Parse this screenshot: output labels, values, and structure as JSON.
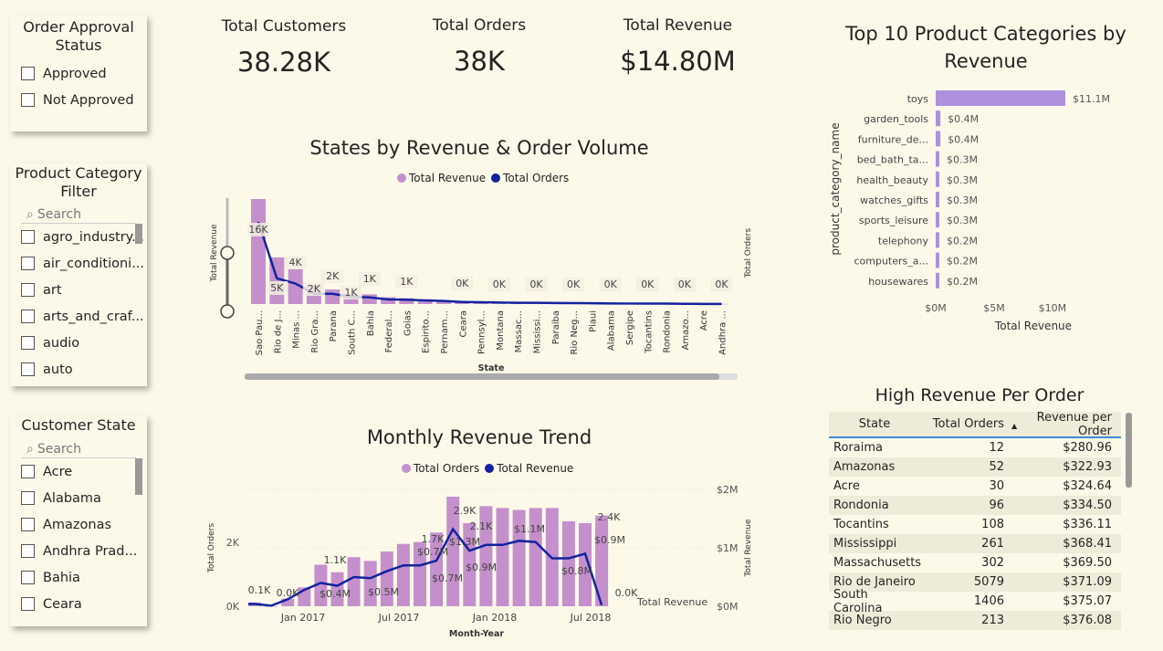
{
  "slicer_approval": {
    "title": "Order Approval Status",
    "items": [
      "Approved",
      "Not Approved"
    ]
  },
  "slicer_category": {
    "title": "Product Category Filter",
    "search_placeholder": "Search",
    "items": [
      "agro_industry...",
      "air_conditioni...",
      "art",
      "arts_and_craf...",
      "audio",
      "auto"
    ]
  },
  "slicer_state": {
    "title": "Customer State",
    "search_placeholder": "Search",
    "items": [
      "Acre",
      "Alabama",
      "Amazonas",
      "Andhra Prad...",
      "Bahia",
      "Ceara"
    ]
  },
  "kpis": {
    "customers_label": "Total Customers",
    "customers_value": "38.28K",
    "orders_label": "Total Orders",
    "orders_value": "38K",
    "revenue_label": "Total Revenue",
    "revenue_value": "$14.80M"
  },
  "states_chart": {
    "title": "States by Revenue & Order Volume",
    "legend": [
      "Total Revenue",
      "Total Orders"
    ],
    "xlabel": "State",
    "ylabel_left": "Total Revenue",
    "ylabel_right": "Total Orders"
  },
  "monthly_chart": {
    "title": "Monthly Revenue Trend",
    "legend": [
      "Total Orders",
      "Total Revenue"
    ],
    "xlabel": "Month-Year",
    "ylabel_left": "Total Orders",
    "ylabel_right": "Total Revenue",
    "line_end_label": "Total Revenue"
  },
  "top10_chart": {
    "title": "Top 10 Product Categories by Revenue",
    "xlabel": "Total Revenue",
    "ylabel": "product_category_name"
  },
  "table": {
    "title": "High Revenue Per Order",
    "headers": [
      "State",
      "Total Orders",
      "Revenue per Order"
    ],
    "rows": [
      [
        "Roraima",
        "12",
        "$280.96"
      ],
      [
        "Amazonas",
        "52",
        "$322.93"
      ],
      [
        "Acre",
        "30",
        "$324.64"
      ],
      [
        "Rondonia",
        "96",
        "$334.50"
      ],
      [
        "Tocantins",
        "108",
        "$336.11"
      ],
      [
        "Mississippi",
        "261",
        "$368.41"
      ],
      [
        "Massachusetts",
        "302",
        "$369.50"
      ],
      [
        "Rio de Janeiro",
        "5079",
        "$371.09"
      ],
      [
        "South Carolina",
        "1406",
        "$375.07"
      ],
      [
        "Rio Negro",
        "213",
        "$376.08"
      ]
    ]
  },
  "colors": {
    "bar_purple": "#c490cb",
    "top10_bar": "#ae90dc",
    "line_navy": "#12239e",
    "background": "#fcf9e9"
  },
  "chart_data": [
    {
      "type": "bar",
      "title": "States by Revenue & Order Volume",
      "xlabel": "State",
      "ylabel": "Total Revenue",
      "categories": [
        "Sao Pau...",
        "Rio de J...",
        "Minas ...",
        "Rio Gra...",
        "Parana",
        "South C...",
        "Bahia",
        "Federal...",
        "Goias",
        "Espirito...",
        "Pernam...",
        "Ceara",
        "Pennsyl...",
        "Montana",
        "Massac...",
        "Mississi...",
        "Paraiba",
        "Rio Neg...",
        "Piaui",
        "Alabama",
        "Sergipe",
        "Tocantins",
        "Rondonia",
        "Amazo...",
        "Acre",
        "Andhra ..."
      ],
      "series": [
        {
          "name": "Total Revenue",
          "values": [
            5.4,
            2.4,
            1.8,
            1.0,
            0.75,
            0.55,
            0.5,
            0.35,
            0.3,
            0.25,
            0.2,
            0.15,
            0.12,
            0.1,
            0.1,
            0.08,
            0.07,
            0.07,
            0.06,
            0.06,
            0.05,
            0.04,
            0.03,
            0.02,
            0.01,
            0.01
          ]
        },
        {
          "name": "Total Orders",
          "values": [
            16000,
            5000,
            4000,
            2000,
            2000,
            1400,
            1300,
            900,
            850,
            700,
            600,
            400,
            350,
            300,
            250,
            250,
            200,
            180,
            150,
            120,
            100,
            100,
            90,
            50,
            30,
            20
          ]
        }
      ],
      "data_labels": [
        "16K",
        "5K",
        "4K",
        "2K",
        "2K",
        "1K",
        "1K",
        "1K",
        "0K",
        "0K",
        "0K",
        "0K",
        "0K",
        "0K",
        "0K",
        "0K",
        "0K"
      ]
    },
    {
      "type": "bar",
      "title": "Monthly Revenue Trend",
      "xlabel": "Month-Year",
      "ylabel": "Total Orders",
      "x_ticks": [
        "Jan 2017",
        "Jul 2017",
        "Jan 2018",
        "Jul 2018"
      ],
      "y_ticks_left": [
        "0K",
        "2K"
      ],
      "y_ticks_right": [
        "$0M",
        "$1M",
        "$2M"
      ],
      "series": [
        {
          "name": "Total Orders",
          "values": [
            100,
            0,
            200,
            500,
            1100,
            900,
            1300,
            1200,
            1450,
            1650,
            1700,
            1950,
            2900,
            2200,
            2650,
            2600,
            2550,
            2600,
            2600,
            2250,
            2200,
            2400
          ]
        },
        {
          "name": "Total Revenue",
          "values": [
            0.04,
            0.01,
            0.12,
            0.28,
            0.4,
            0.35,
            0.5,
            0.48,
            0.6,
            0.7,
            0.7,
            0.78,
            1.32,
            0.95,
            1.05,
            1.05,
            1.12,
            1.1,
            0.82,
            0.82,
            0.9,
            0.02
          ]
        }
      ],
      "data_labels": [
        "0.1K",
        "0.0K",
        "1.1K",
        "1.7K",
        "2.9K",
        "2.1K",
        "2.4K",
        "0.0K",
        "$0.4M",
        "$0.5M",
        "$0.7M",
        "$0.7M",
        "$1.3M",
        "$0.9M",
        "$1.1M",
        "$0.8M",
        "$0.9M"
      ]
    },
    {
      "type": "bar",
      "title": "Top 10 Product Categories by Revenue",
      "xlabel": "Total Revenue",
      "ylabel": "product_category_name",
      "categories": [
        "toys",
        "garden_tools",
        "furniture_de...",
        "bed_bath_ta...",
        "health_beauty",
        "watches_gifts",
        "sports_leisure",
        "telephony",
        "computers_a...",
        "housewares"
      ],
      "values": [
        11.1,
        0.4,
        0.4,
        0.3,
        0.3,
        0.3,
        0.3,
        0.2,
        0.2,
        0.2
      ],
      "value_labels": [
        "$11.1M",
        "$0.4M",
        "$0.4M",
        "$0.3M",
        "$0.3M",
        "$0.3M",
        "$0.3M",
        "$0.2M",
        "$0.2M",
        "$0.2M"
      ],
      "x_ticks": [
        "$0M",
        "$5M",
        "$10M"
      ],
      "xlim": [
        0,
        12
      ]
    }
  ]
}
